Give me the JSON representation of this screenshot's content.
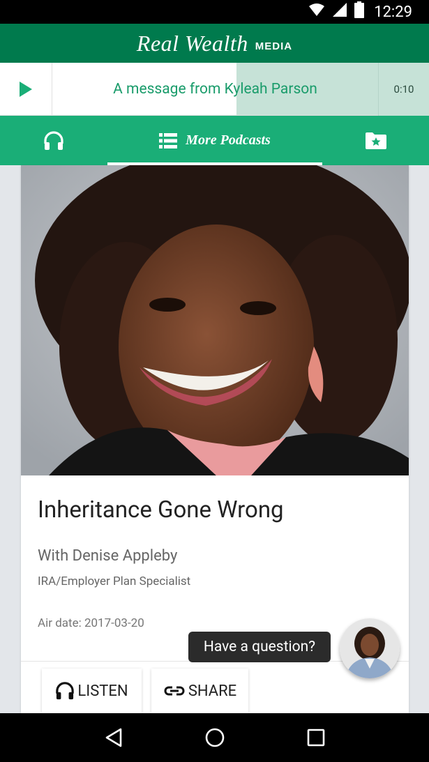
{
  "status_bar": {
    "time": "12:29",
    "icons": [
      "wifi-icon",
      "signal-icon",
      "battery-icon"
    ]
  },
  "brand": {
    "script": "Real Wealth",
    "suffix": "MEDIA"
  },
  "player": {
    "track_title": "A message from Kyleah Parson",
    "time": "0:10",
    "progress": 0.435
  },
  "tabs": {
    "listen_icon": "headphones-icon",
    "more_label": "More Podcasts",
    "more_icon": "list-icon",
    "favorites_icon": "star-folder-icon",
    "active": "more"
  },
  "episode": {
    "title": "Inheritance Gone Wrong",
    "host": "With Denise Appleby",
    "role": "IRA/Employer Plan Specialist",
    "air_date": "Air date: 2017-03-20",
    "listen_label": "LISTEN",
    "share_label": "SHARE"
  },
  "chat": {
    "prompt": "Have a question?"
  },
  "colors": {
    "brand_green": "#007a4d",
    "tab_green": "#1aae77",
    "accent_text": "#1a9c6b",
    "progress": "#c6e2d7"
  }
}
